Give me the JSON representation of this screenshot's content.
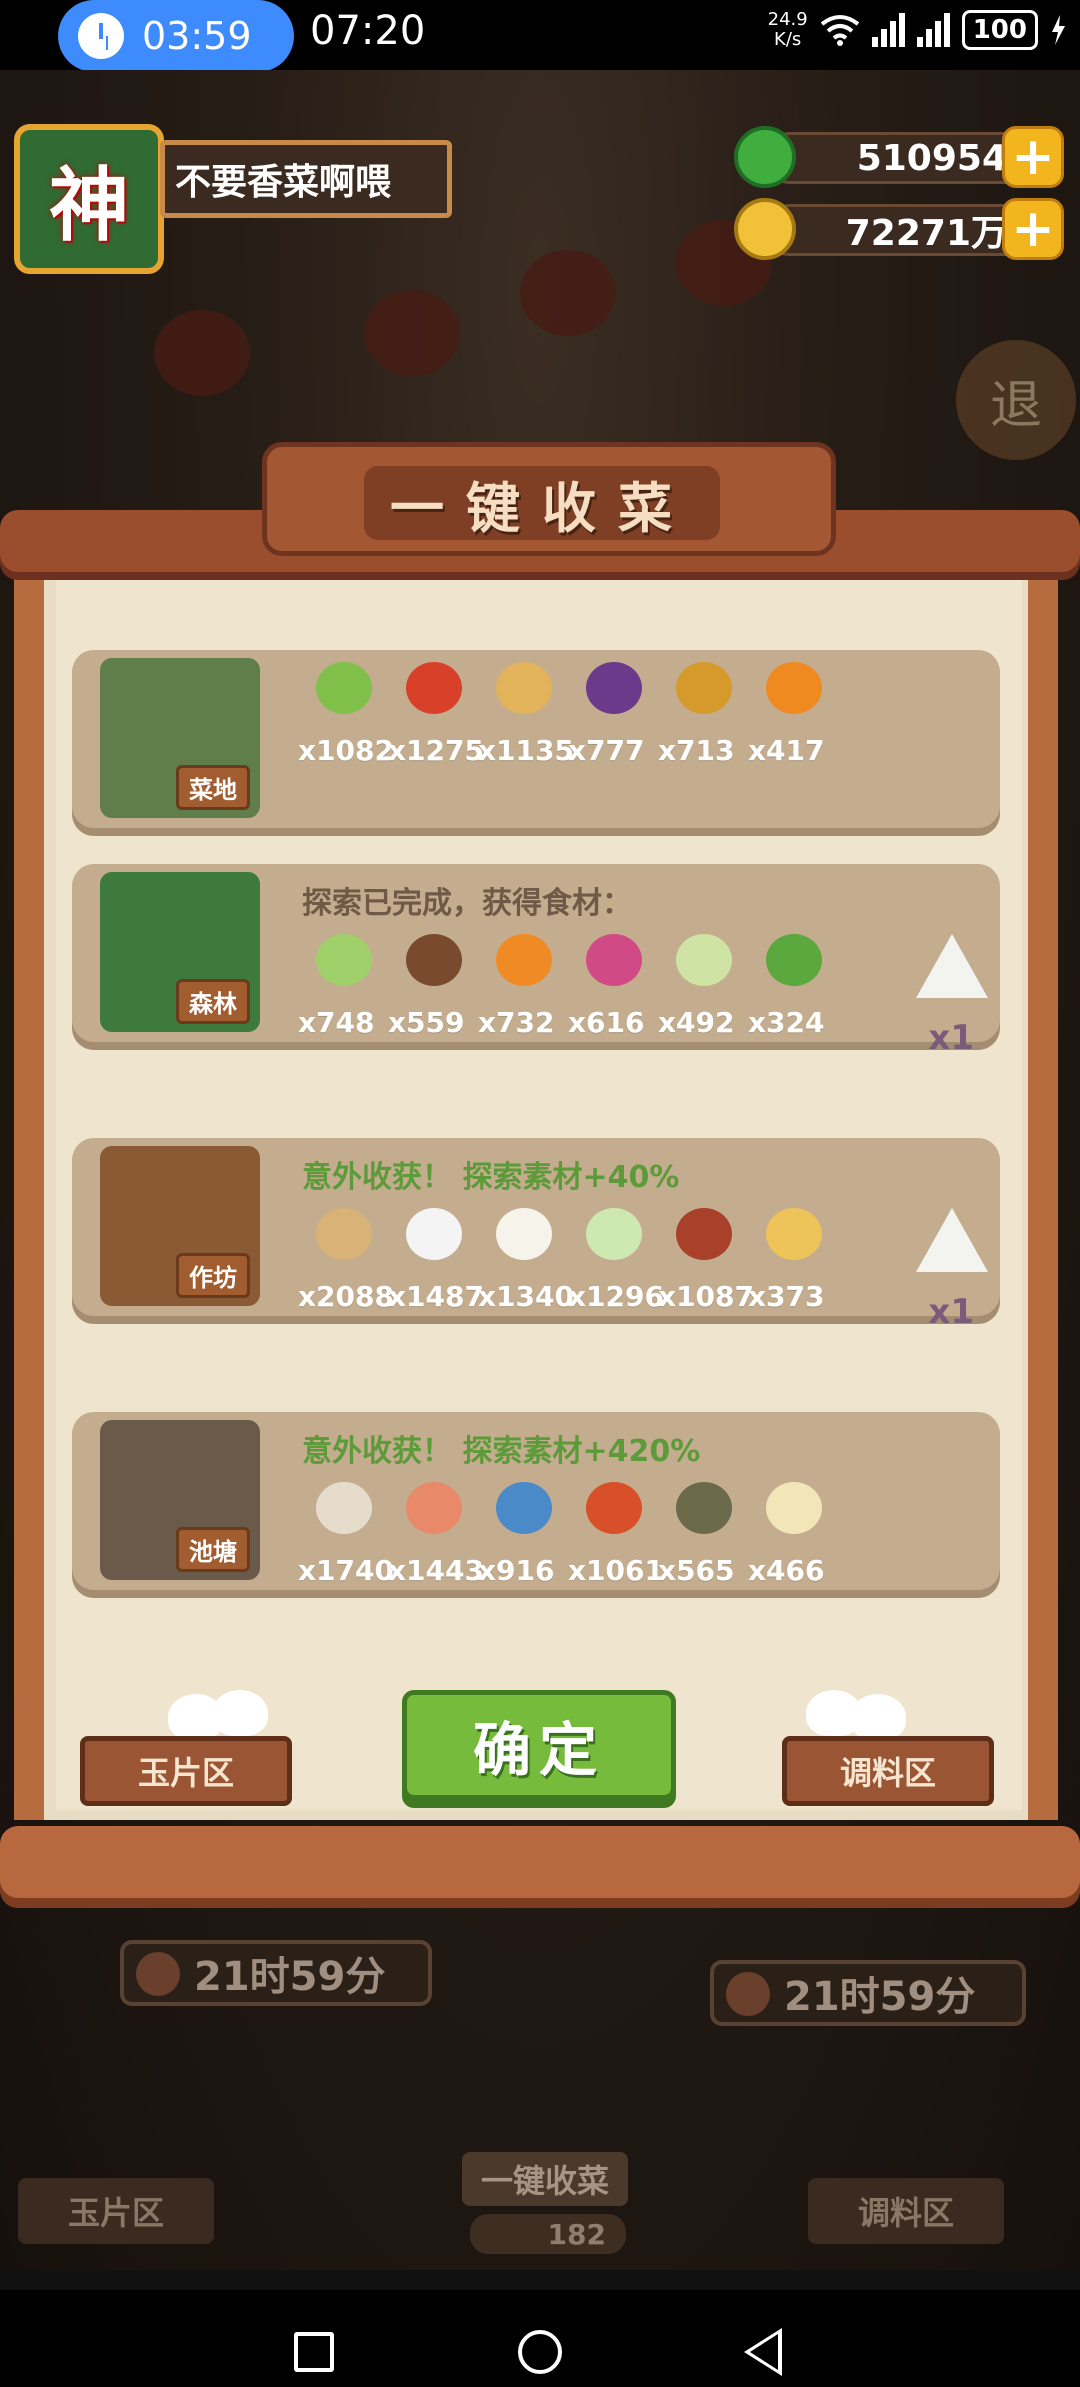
{
  "status_bar": {
    "alarm_time": "03:59",
    "time": "07:20",
    "net_speed_value": "24.9",
    "net_speed_unit": "K/s",
    "battery": "100"
  },
  "player": {
    "avatar_glyph": "神",
    "name": "不要香菜啊喂"
  },
  "resources": {
    "jade": "510954",
    "gold": "72271万"
  },
  "exit_label": "退",
  "dialog": {
    "title": "一键收菜",
    "rows": [
      {
        "building": "菜地",
        "note": "",
        "items": [
          {
            "icon": "leek-icon",
            "color": "#7fbf4a",
            "count": "x1082"
          },
          {
            "icon": "chili-icon",
            "color": "#d8402a",
            "count": "x1275"
          },
          {
            "icon": "potato-icon",
            "color": "#e2b35a",
            "count": "x1135"
          },
          {
            "icon": "eggplant-icon",
            "color": "#6b3a8a",
            "count": "x777"
          },
          {
            "icon": "pineapple-icon",
            "color": "#d69a2c",
            "count": "x713"
          },
          {
            "icon": "pumpkin-icon",
            "color": "#ee8a20",
            "count": "x417"
          }
        ],
        "bonus": ""
      },
      {
        "building": "森林",
        "note": "探索已完成，获得食材：",
        "note_color": "#6e5a47",
        "items": [
          {
            "icon": "cabbage-icon",
            "color": "#9fd06a",
            "count": "x748"
          },
          {
            "icon": "mushroom-icon",
            "color": "#7a4a2e",
            "count": "x559"
          },
          {
            "icon": "carrot-icon",
            "color": "#f08a24",
            "count": "x732"
          },
          {
            "icon": "onion-icon",
            "color": "#d04a86",
            "count": "x616"
          },
          {
            "icon": "bamboo-shoot-icon",
            "color": "#cfe3a4",
            "count": "x492"
          },
          {
            "icon": "herb-icon",
            "color": "#5aa83e",
            "count": "x324"
          }
        ],
        "bonus": "x1"
      },
      {
        "building": "作坊",
        "note": "意外收获！ 探索素材+40%",
        "note_color": "#5d9a3a",
        "items": [
          {
            "icon": "flour-sack-icon",
            "color": "#d8b277",
            "count": "x2088"
          },
          {
            "icon": "rice-bowl-icon",
            "color": "#f4f4f4",
            "count": "x1487"
          },
          {
            "icon": "tofu-icon",
            "color": "#f6f3ea",
            "count": "x1340"
          },
          {
            "icon": "sticky-rice-icon",
            "color": "#cde8b0",
            "count": "x1296"
          },
          {
            "icon": "sauce-jar-icon",
            "color": "#a8402a",
            "count": "x1087"
          },
          {
            "icon": "gravy-boat-icon",
            "color": "#eec35a",
            "count": "x373"
          }
        ],
        "bonus": "x1"
      },
      {
        "building": "池塘",
        "note": "意外收获！ 探索素材+420%",
        "note_color": "#5d9a3a",
        "items": [
          {
            "icon": "clam-icon",
            "color": "#e6dccc",
            "count": "x1740"
          },
          {
            "icon": "shrimp-icon",
            "color": "#e88a6a",
            "count": "x1443"
          },
          {
            "icon": "fish-icon",
            "color": "#4a8ac8",
            "count": "x916"
          },
          {
            "icon": "meat-icon",
            "color": "#d8502a",
            "count": "x1061"
          },
          {
            "icon": "crab-icon",
            "color": "#6a6a4a",
            "count": "x565"
          },
          {
            "icon": "shark-fin-icon",
            "color": "#f2e6b8",
            "count": "x466"
          }
        ],
        "bonus": ""
      }
    ],
    "confirm_label": "确定",
    "left_nav_label": "玉片区",
    "right_nav_label": "调料区"
  },
  "background": {
    "timer_left": "21时59分",
    "timer_right": "21时59分",
    "left_area_label": "玉片区",
    "right_area_label": "调料区",
    "harvest_label": "一键收菜",
    "harvest_count": "182"
  },
  "colors": {
    "confirm_green": "#77bb3c",
    "frame_brown": "#b8683e",
    "gold": "#f3b51e"
  }
}
